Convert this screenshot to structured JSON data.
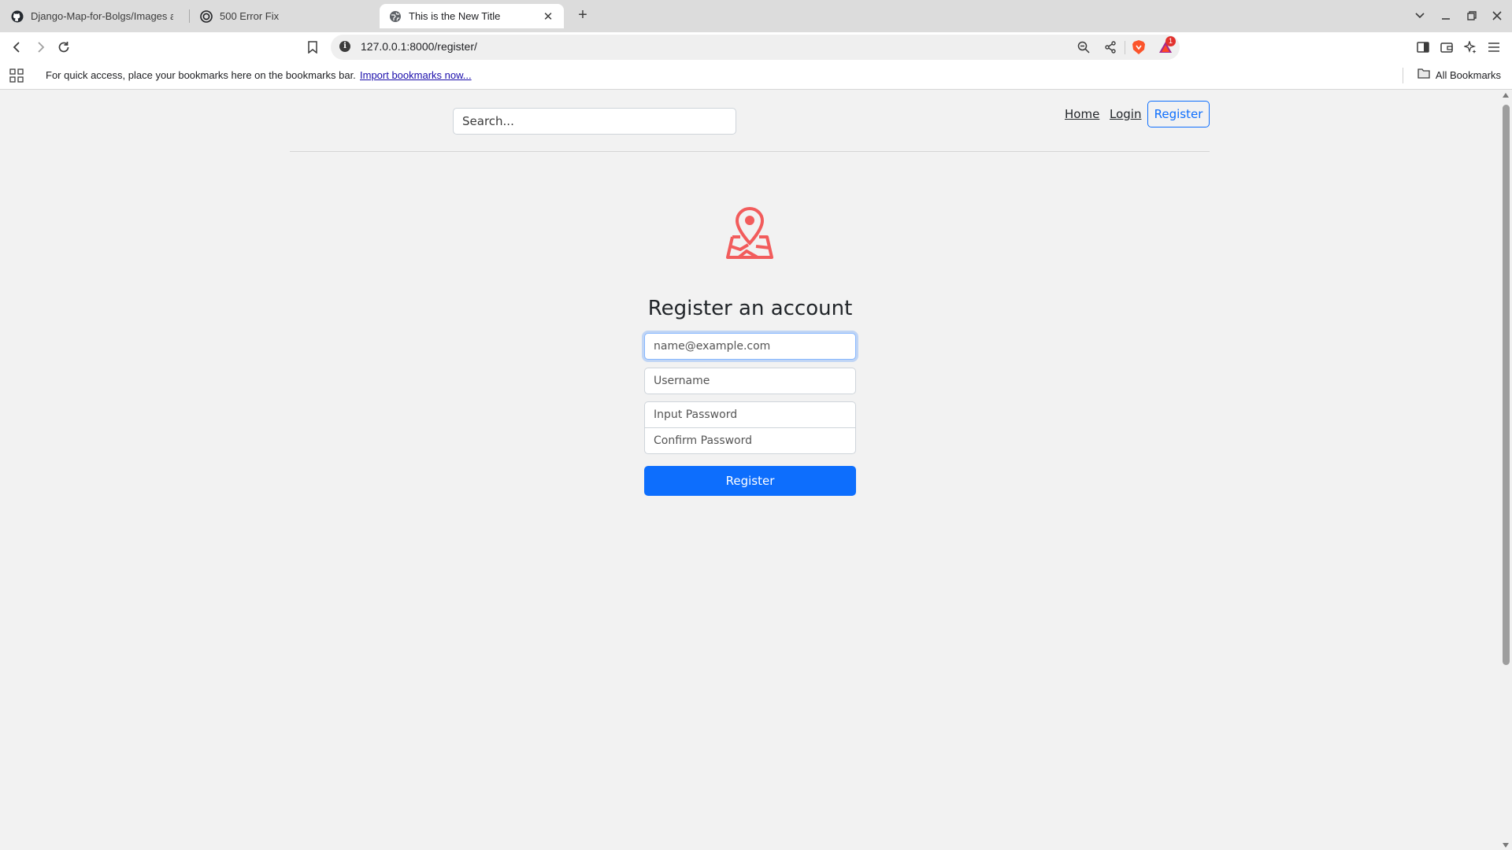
{
  "browser": {
    "tabs": [
      {
        "title": "Django-Map-for-Bolgs/Images a",
        "icon": "github-icon"
      },
      {
        "title": "500 Error Fix",
        "icon": "openai-icon"
      },
      {
        "title": "This is the New Title",
        "icon": "globe-icon",
        "active": true
      }
    ],
    "url": "127.0.0.1:8000/register/",
    "shields_badge": "1",
    "bookmarks_hint": "For quick access, place your bookmarks here on the bookmarks bar.",
    "import_link": "Import bookmarks now...",
    "all_bookmarks": "All Bookmarks"
  },
  "nav": {
    "search_placeholder": "Search...",
    "home": "Home",
    "login": "Login",
    "register": "Register"
  },
  "form": {
    "title": "Register an account",
    "email_placeholder": "name@example.com",
    "username_placeholder": "Username",
    "password_placeholder": "Input Password",
    "confirm_placeholder": "Confirm Password",
    "submit": "Register"
  },
  "colors": {
    "primary": "#0d6efd",
    "logo": "#f25c5c",
    "page_bg": "#f2f2f2"
  }
}
